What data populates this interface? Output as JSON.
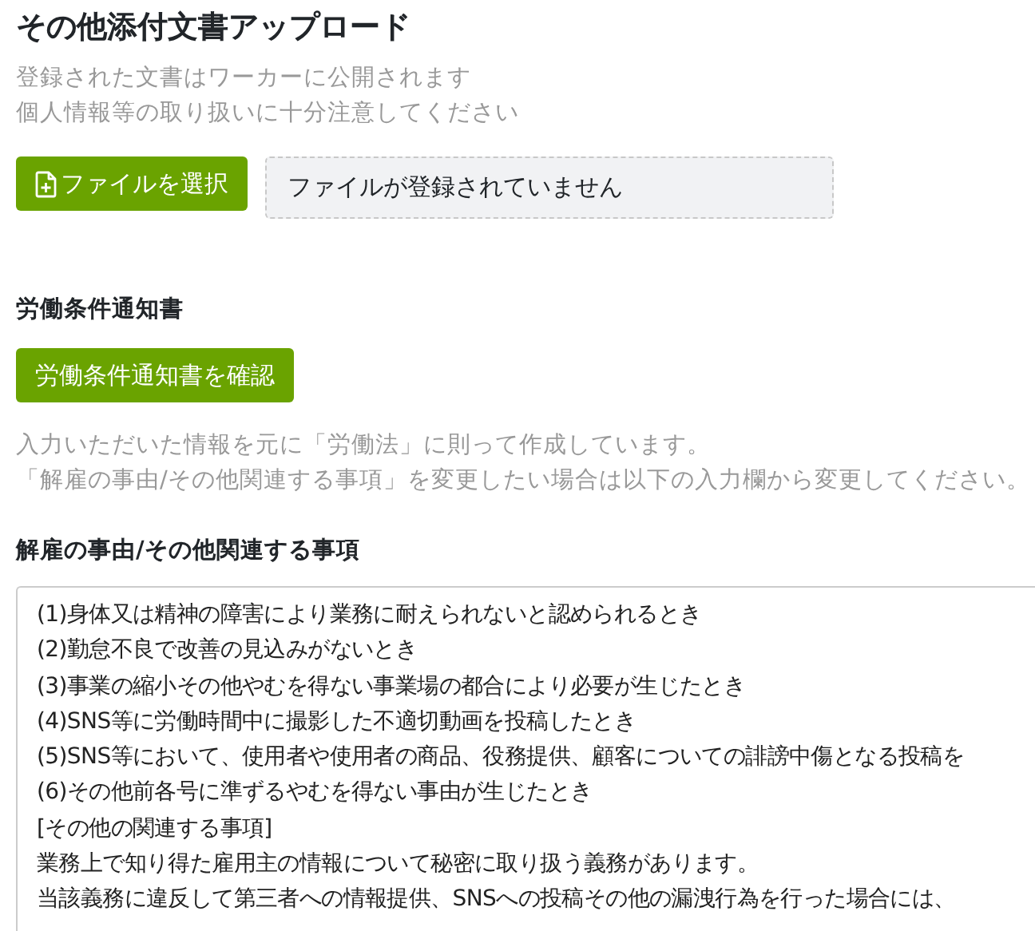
{
  "upload": {
    "title": "その他添付文書アップロード",
    "notes": [
      "登録された文書はワーカーに公開されます",
      "個人情報等の取り扱いに十分注意してください"
    ],
    "button": "ファイルを選択",
    "file_field": {
      "placeholder": "ファイルが登録されていません"
    }
  },
  "notice": {
    "heading": "労働条件通知書",
    "button": "労働条件通知書を確認",
    "notes": [
      "入力いただいた情報を元に「労働法」に則って作成しています。",
      "「解雇の事由/その他関連する事項」を変更したい場合は以下の入力欄から変更してください。"
    ]
  },
  "dismissal": {
    "label": "解雇の事由/その他関連する事項",
    "value": [
      "(1)身体又は精神の障害により業務に耐えられないと認められるとき",
      "(2)勤怠不良で改善の見込みがないとき",
      "(3)事業の縮小その他やむを得ない事業場の都合により必要が生じたとき",
      "(4)SNS等に労働時間中に撮影した不適切動画を投稿したとき",
      "(5)SNS等において、使用者や使用者の商品、役務提供、顧客についての誹謗中傷となる投稿を",
      "(6)その他前各号に準ずるやむを得ない事由が生じたとき",
      "[その他の関連する事項]",
      "業務上で知り得た雇用主の情報について秘密に取り扱う義務があります。",
      "当該義務に違反して第三者への情報提供、SNSへの投稿その他の漏洩行為を行った場合には、"
    ]
  }
}
